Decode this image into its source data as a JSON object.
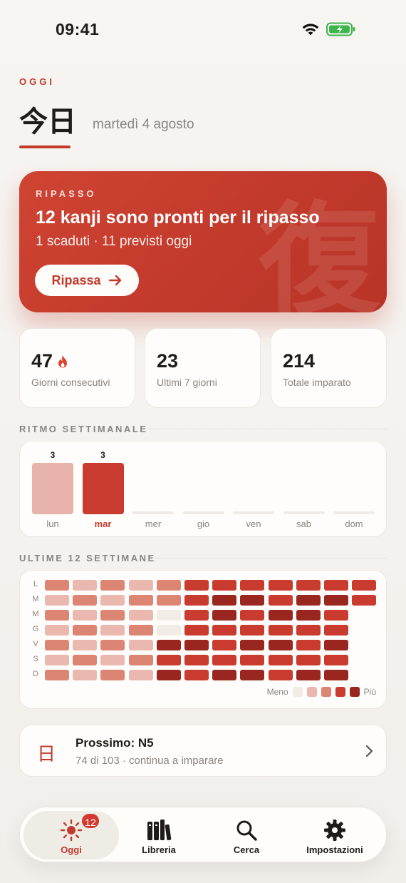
{
  "status_bar": {
    "time": "09:41"
  },
  "header": {
    "section_tag": "OGGI",
    "title": "今日",
    "date": "martedì 4 agosto"
  },
  "review": {
    "tag": "RIPASSO",
    "title": "12 kanji sono pronti per il ripasso",
    "subtitle": "1 scaduti · 11 previsti oggi",
    "button_label": "Ripassa",
    "watermark": "復"
  },
  "stats": [
    {
      "value": "47",
      "label": "Giorni consecutivi",
      "icon": "flame-icon"
    },
    {
      "value": "23",
      "label": "Ultimi 7 giorni"
    },
    {
      "value": "214",
      "label": "Totale imparato"
    }
  ],
  "weekly": {
    "heading": "RITMO SETTIMANALE",
    "chart_data": {
      "type": "bar",
      "categories": [
        "lun",
        "mar",
        "mer",
        "gio",
        "ven",
        "sab",
        "dom"
      ],
      "values": [
        3,
        3,
        0,
        0,
        0,
        0,
        0
      ],
      "data_labels": [
        "3",
        "3",
        "",
        "",
        "",
        "",
        ""
      ],
      "highlighted": "mar"
    }
  },
  "heatmap": {
    "heading": "ULTIME 12 SETTIMANE",
    "row_labels": [
      "L",
      "M",
      "M",
      "G",
      "V",
      "S",
      "D"
    ],
    "levels": [
      [
        2,
        1,
        2,
        1,
        2,
        3,
        3,
        3,
        3,
        3,
        3,
        3
      ],
      [
        1,
        2,
        1,
        2,
        2,
        3,
        4,
        4,
        3,
        4,
        4,
        3
      ],
      [
        2,
        1,
        2,
        1,
        0,
        3,
        4,
        3,
        4,
        4,
        3,
        -1
      ],
      [
        1,
        2,
        1,
        2,
        0,
        3,
        3,
        3,
        3,
        3,
        3,
        -1
      ],
      [
        2,
        1,
        2,
        1,
        4,
        4,
        3,
        4,
        4,
        3,
        4,
        -1
      ],
      [
        1,
        2,
        1,
        2,
        3,
        3,
        3,
        3,
        3,
        3,
        3,
        -1
      ],
      [
        2,
        1,
        2,
        1,
        4,
        3,
        4,
        4,
        3,
        4,
        4,
        -1
      ]
    ],
    "palette": [
      "#f1ede6",
      "#ebb8b0",
      "#dd8573",
      "#c83b2e",
      "#99271f"
    ],
    "legend_less": "Meno",
    "legend_more": "Più"
  },
  "next": {
    "glyph": "日",
    "title": "Prossimo: N5",
    "subtitle": "74 di 103 · continua a imparare"
  },
  "tabs": [
    {
      "label": "Oggi",
      "icon": "sun-icon",
      "badge": "12",
      "active": true
    },
    {
      "label": "Libreria",
      "icon": "books-icon"
    },
    {
      "label": "Cerca",
      "icon": "search-icon"
    },
    {
      "label": "Impostazioni",
      "icon": "gear-icon"
    }
  ],
  "colors": {
    "accent": "#c23a2c",
    "background": "#f5f3f0",
    "card": "#fffdfb",
    "muted_text": "#8a8480",
    "bar_light": "#e8b3aa",
    "bar_active": "#c83b2e"
  }
}
